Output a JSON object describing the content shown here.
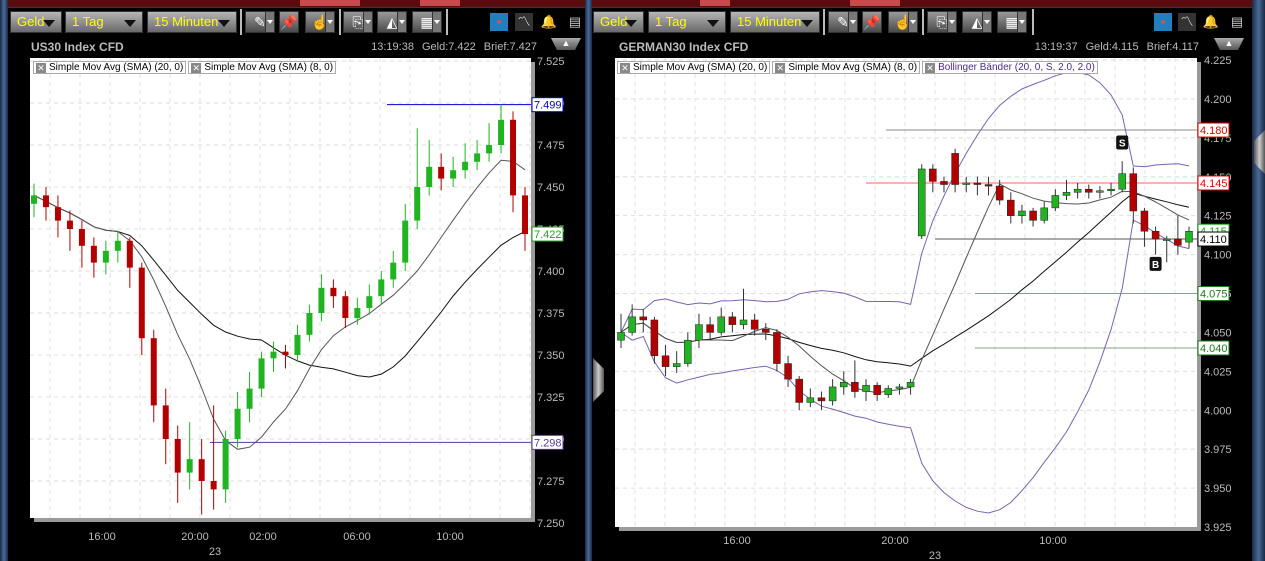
{
  "left": {
    "toolbar": {
      "price_type": "Geld",
      "period": "1 Tag",
      "interval": "15 Minuten"
    },
    "title": "US30 Index CFD",
    "time": "13:19:38",
    "bid": "Geld:7.422",
    "ask": "Brief:7.427",
    "indicators": [
      "Simple Mov Avg (SMA) (20, 0)",
      "Simple Mov Avg (SMA) (8, 0)"
    ]
  },
  "right": {
    "toolbar": {
      "price_type": "Geld",
      "period": "1 Tag",
      "interval": "15 Minuten"
    },
    "title": "GERMAN30 Index CFD",
    "time": "13:19:37",
    "bid": "Geld:4.115",
    "ask": "Brief:4.117",
    "indicators": [
      "Simple Mov Avg (SMA) (20, 0)",
      "Simple Mov Avg (SMA) (8, 0)",
      "Bollinger Bänder (20, 0, S, 2.0, 2.0)"
    ]
  },
  "colors": {
    "up": "#22b322",
    "down": "#b30000",
    "sma20": "#111111",
    "sma8": "#555555",
    "bollinger": "#7a62b0",
    "button_text": "#ffff00"
  },
  "chart_data": [
    {
      "type": "candlestick",
      "title": "US30 Index CFD",
      "ylim": [
        7.25,
        7.525
      ],
      "yticks": [
        "7.525",
        "7.500",
        "7.475",
        "7.450",
        "7.425",
        "7.400",
        "7.375",
        "7.350",
        "7.325",
        "7.300",
        "7.275",
        "7.250"
      ],
      "xticks": [
        "16:00",
        "20:00",
        "02:00",
        "06:00",
        "10:00"
      ],
      "date_label": "23",
      "ohlc": [
        [
          7.44,
          7.452,
          7.432,
          7.445
        ],
        [
          7.445,
          7.45,
          7.43,
          7.438
        ],
        [
          7.438,
          7.445,
          7.42,
          7.43
        ],
        [
          7.43,
          7.436,
          7.412,
          7.425
        ],
        [
          7.425,
          7.43,
          7.402,
          7.415
        ],
        [
          7.415,
          7.42,
          7.396,
          7.405
        ],
        [
          7.405,
          7.418,
          7.398,
          7.412
        ],
        [
          7.412,
          7.424,
          7.405,
          7.418
        ],
        [
          7.418,
          7.42,
          7.39,
          7.402
        ],
        [
          7.402,
          7.405,
          7.35,
          7.36
        ],
        [
          7.36,
          7.365,
          7.31,
          7.32
        ],
        [
          7.32,
          7.33,
          7.285,
          7.3
        ],
        [
          7.3,
          7.308,
          7.262,
          7.28
        ],
        [
          7.28,
          7.31,
          7.27,
          7.288
        ],
        [
          7.288,
          7.3,
          7.255,
          7.275
        ],
        [
          7.275,
          7.32,
          7.258,
          7.27
        ],
        [
          7.27,
          7.305,
          7.262,
          7.3
        ],
        [
          7.3,
          7.328,
          7.295,
          7.318
        ],
        [
          7.318,
          7.34,
          7.31,
          7.33
        ],
        [
          7.33,
          7.352,
          7.325,
          7.348
        ],
        [
          7.348,
          7.358,
          7.34,
          7.352
        ],
        [
          7.352,
          7.356,
          7.342,
          7.35
        ],
        [
          7.35,
          7.368,
          7.346,
          7.362
        ],
        [
          7.362,
          7.38,
          7.358,
          7.375
        ],
        [
          7.375,
          7.398,
          7.37,
          7.39
        ],
        [
          7.39,
          7.395,
          7.378,
          7.385
        ],
        [
          7.385,
          7.388,
          7.366,
          7.372
        ],
        [
          7.372,
          7.384,
          7.368,
          7.378
        ],
        [
          7.378,
          7.392,
          7.374,
          7.385
        ],
        [
          7.385,
          7.4,
          7.38,
          7.395
        ],
        [
          7.395,
          7.412,
          7.39,
          7.405
        ],
        [
          7.405,
          7.44,
          7.4,
          7.43
        ],
        [
          7.43,
          7.485,
          7.425,
          7.45
        ],
        [
          7.45,
          7.478,
          7.445,
          7.462
        ],
        [
          7.462,
          7.47,
          7.448,
          7.455
        ],
        [
          7.455,
          7.468,
          7.45,
          7.46
        ],
        [
          7.46,
          7.476,
          7.455,
          7.465
        ],
        [
          7.465,
          7.478,
          7.46,
          7.47
        ],
        [
          7.47,
          7.488,
          7.465,
          7.475
        ],
        [
          7.475,
          7.499,
          7.47,
          7.49
        ],
        [
          7.49,
          7.495,
          7.435,
          7.445
        ],
        [
          7.445,
          7.45,
          7.412,
          7.422
        ]
      ],
      "sma": [
        20,
        8
      ],
      "levels": [
        {
          "value": 7.499,
          "label": "7.499",
          "color": "#0000cc",
          "line": true
        },
        {
          "value": 7.422,
          "label": "7.422",
          "color": "#22a022",
          "line": false
        },
        {
          "value": 7.298,
          "label": "7.298",
          "color": "#5a3a9a",
          "line": true
        }
      ]
    },
    {
      "type": "candlestick",
      "title": "GERMAN30 Index CFD",
      "ylim": [
        3.925,
        4.225
      ],
      "yticks": [
        "4.225",
        "4.200",
        "4.175",
        "4.150",
        "4.125",
        "4.100",
        "4.075",
        "4.050",
        "4.025",
        "4.000",
        "3.975",
        "3.950",
        "3.925"
      ],
      "xticks": [
        "16:00",
        "20:00",
        "10:00"
      ],
      "date_label": "23",
      "ohlc": [
        [
          4.045,
          4.062,
          4.04,
          4.05
        ],
        [
          4.05,
          4.068,
          4.048,
          4.06
        ],
        [
          4.06,
          4.065,
          4.05,
          4.058
        ],
        [
          4.058,
          4.06,
          4.03,
          4.035
        ],
        [
          4.035,
          4.042,
          4.022,
          4.028
        ],
        [
          4.028,
          4.038,
          4.024,
          4.03
        ],
        [
          4.03,
          4.05,
          4.028,
          4.045
        ],
        [
          4.045,
          4.062,
          4.04,
          4.055
        ],
        [
          4.055,
          4.06,
          4.045,
          4.05
        ],
        [
          4.05,
          4.066,
          4.048,
          4.06
        ],
        [
          4.06,
          4.063,
          4.05,
          4.055
        ],
        [
          4.055,
          4.078,
          4.052,
          4.058
        ],
        [
          4.058,
          4.062,
          4.048,
          4.052
        ],
        [
          4.052,
          4.056,
          4.045,
          4.05
        ],
        [
          4.05,
          4.052,
          4.025,
          4.03
        ],
        [
          4.03,
          4.035,
          4.015,
          4.02
        ],
        [
          4.02,
          4.022,
          4.0,
          4.005
        ],
        [
          4.005,
          4.014,
          4.002,
          4.008
        ],
        [
          4.008,
          4.012,
          4.0,
          4.006
        ],
        [
          4.006,
          4.02,
          4.003,
          4.015
        ],
        [
          4.015,
          4.025,
          4.01,
          4.018
        ],
        [
          4.018,
          4.032,
          4.008,
          4.012
        ],
        [
          4.012,
          4.02,
          4.006,
          4.016
        ],
        [
          4.016,
          4.018,
          4.006,
          4.01
        ],
        [
          4.01,
          4.016,
          4.008,
          4.014
        ],
        [
          4.014,
          4.017,
          4.01,
          4.015
        ],
        [
          4.015,
          4.02,
          4.01,
          4.018
        ],
        [
          4.112,
          4.158,
          4.11,
          4.155
        ],
        [
          4.155,
          4.158,
          4.14,
          4.147
        ],
        [
          4.147,
          4.15,
          4.14,
          4.145
        ],
        [
          4.165,
          4.168,
          4.14,
          4.145
        ],
        [
          4.145,
          4.15,
          4.14,
          4.146
        ],
        [
          4.146,
          4.15,
          4.138,
          4.145
        ],
        [
          4.145,
          4.15,
          4.138,
          4.144
        ],
        [
          4.144,
          4.148,
          4.132,
          4.135
        ],
        [
          4.135,
          4.14,
          4.12,
          4.125
        ],
        [
          4.125,
          4.132,
          4.12,
          4.128
        ],
        [
          4.128,
          4.13,
          4.118,
          4.122
        ],
        [
          4.122,
          4.134,
          4.12,
          4.13
        ],
        [
          4.13,
          4.142,
          4.128,
          4.138
        ],
        [
          4.138,
          4.148,
          4.135,
          4.14
        ],
        [
          4.14,
          4.146,
          4.136,
          4.142
        ],
        [
          4.142,
          4.145,
          4.136,
          4.14
        ],
        [
          4.14,
          4.144,
          4.136,
          4.141
        ],
        [
          4.141,
          4.146,
          4.138,
          4.142
        ],
        [
          4.142,
          4.16,
          4.14,
          4.152
        ],
        [
          4.152,
          4.156,
          4.12,
          4.128
        ],
        [
          4.128,
          4.13,
          4.105,
          4.115
        ],
        [
          4.115,
          4.118,
          4.1,
          4.11
        ],
        [
          4.11,
          4.112,
          4.095,
          4.11
        ],
        [
          4.11,
          4.125,
          4.1,
          4.106
        ],
        [
          4.108,
          4.118,
          4.104,
          4.115
        ]
      ],
      "sma": [
        20,
        8
      ],
      "bollinger": {
        "period": 20,
        "std": 2.0
      },
      "levels": [
        {
          "value": 4.18,
          "label": "4.180",
          "color": "#e00000",
          "line": true,
          "line_color": "#888888"
        },
        {
          "value": 4.146,
          "label": "4.145",
          "color": "#e00000",
          "line": true,
          "line_color": "#ff6060"
        },
        {
          "value": 4.115,
          "label": "4.115",
          "color": "#22a022",
          "line": false
        },
        {
          "value": 4.11,
          "label": "4.110",
          "color": "#000000",
          "line": true,
          "line_color": "#555555"
        },
        {
          "value": 4.075,
          "label": "4.075",
          "color": "#1a7a1a",
          "line": true,
          "line_color": "#8aa08a"
        },
        {
          "value": 4.04,
          "label": "4.040",
          "color": "#1a7a1a",
          "line": true,
          "line_color": "#8aa08a"
        }
      ],
      "markers": [
        {
          "label": "S",
          "candle": 46,
          "value": 4.172,
          "position": "above"
        },
        {
          "label": "B",
          "candle": 49,
          "value": 4.094,
          "position": "below"
        }
      ]
    }
  ]
}
